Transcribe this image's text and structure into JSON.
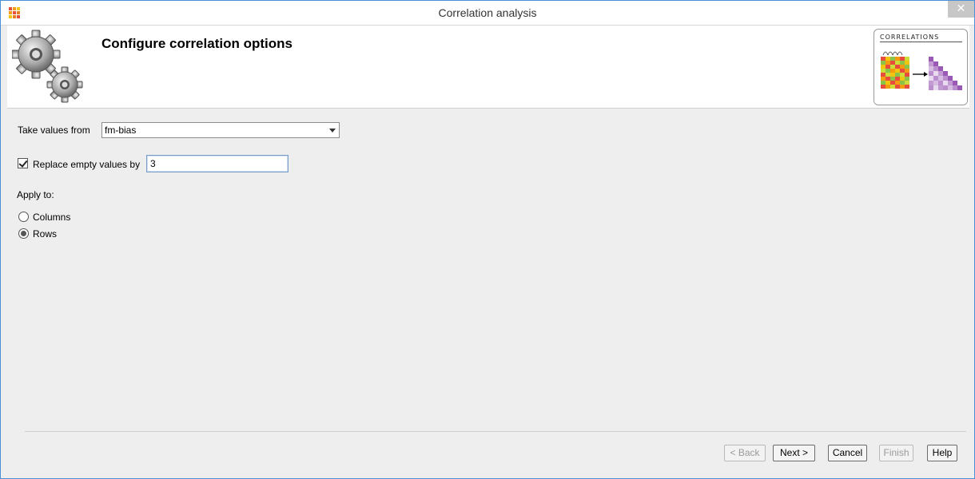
{
  "window": {
    "title": "Correlation analysis",
    "close_glyph": "✕"
  },
  "header": {
    "title": "Configure correlation options",
    "preview_caption": "CORRELATIONS"
  },
  "form": {
    "source_label": "Take values from",
    "source_value": "fm-bias",
    "replace_label": "Replace empty values by",
    "replace_checked": true,
    "replace_value": "3",
    "apply_label": "Apply to:",
    "options": [
      {
        "label": "Columns",
        "selected": false
      },
      {
        "label": "Rows",
        "selected": true
      }
    ]
  },
  "footer": {
    "back": "< Back",
    "next": "Next >",
    "cancel": "Cancel",
    "finish": "Finish",
    "help": "Help"
  },
  "colors": {
    "accent": "#4a90d9",
    "matrix": "#9b59b6"
  }
}
